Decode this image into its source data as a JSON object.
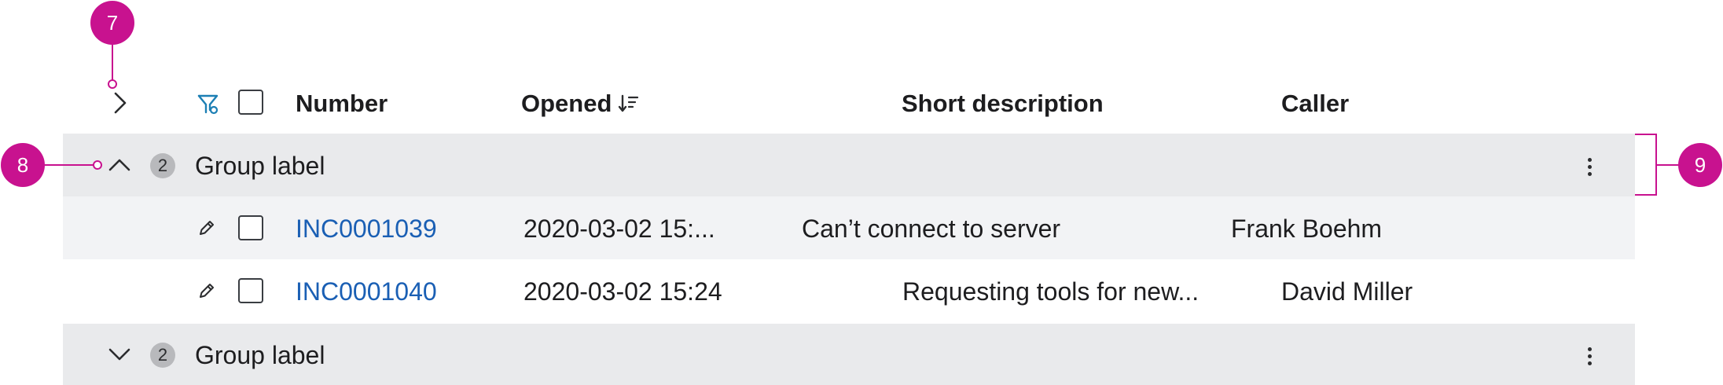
{
  "annotations": {
    "m7": "7",
    "m8": "8",
    "m9": "9"
  },
  "columns": {
    "number": "Number",
    "opened": "Opened",
    "short_description": "Short description",
    "caller": "Caller"
  },
  "groups": [
    {
      "label": "Group label",
      "count": "2",
      "expanded": true,
      "rows": [
        {
          "number": "INC0001039",
          "opened": "2020-03-02 15:...",
          "short_description": "Can’t connect to server",
          "caller": "Frank Boehm"
        },
        {
          "number": "INC0001040",
          "opened": "2020-03-02 15:24",
          "short_description": "Requesting tools for new...",
          "caller": "David Miller"
        }
      ]
    },
    {
      "label": "Group label",
      "count": "2",
      "expanded": false
    }
  ],
  "colors": {
    "accent": "#1b78c9",
    "link": "#1a5fb4",
    "annotation": "#c8128f",
    "group_bg": "#e9eaec"
  },
  "icons": [
    "chevron-right-icon",
    "filter-icon",
    "sort-descending-icon",
    "chevron-up-icon",
    "chevron-down-icon",
    "pencil-icon",
    "more-vertical-icon"
  ]
}
